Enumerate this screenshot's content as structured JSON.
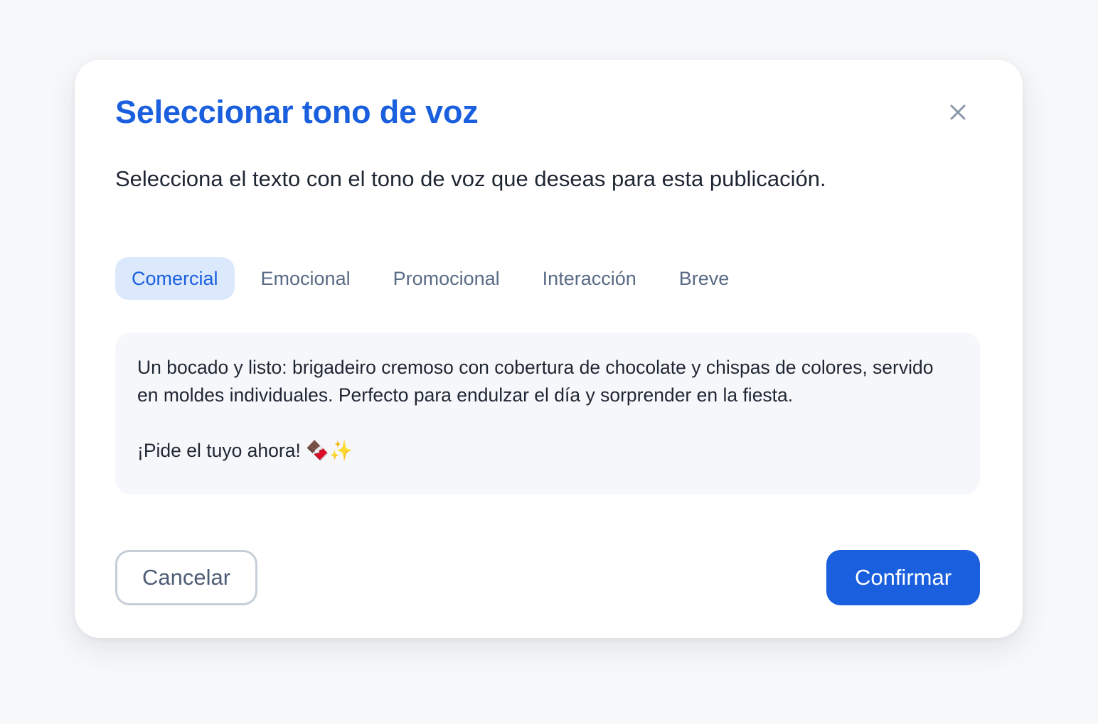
{
  "dialog": {
    "title": "Seleccionar tono de voz",
    "subtitle": "Selecciona el texto con el tono de voz que deseas para esta publicación.",
    "close_icon": "close-icon",
    "tabs": [
      {
        "label": "Comercial",
        "active": true
      },
      {
        "label": "Emocional",
        "active": false
      },
      {
        "label": "Promocional",
        "active": false
      },
      {
        "label": "Interacción",
        "active": false
      },
      {
        "label": "Breve",
        "active": false
      }
    ],
    "content": {
      "paragraph": "Un bocado y listo: brigadeiro cremoso con cobertura de chocolate y chispas de colores, servido en moldes individuales. Perfecto para endulzar el día y sorprender en la fiesta.",
      "cta": "¡Pide el tuyo ahora! 🍫✨"
    },
    "buttons": {
      "cancel": "Cancelar",
      "confirm": "Confirmar"
    }
  },
  "colors": {
    "accent": "#1a5fde",
    "tab_active_bg": "#dce9fc",
    "text_box_bg": "#f5f7fa",
    "muted_text": "#5a6b85"
  }
}
